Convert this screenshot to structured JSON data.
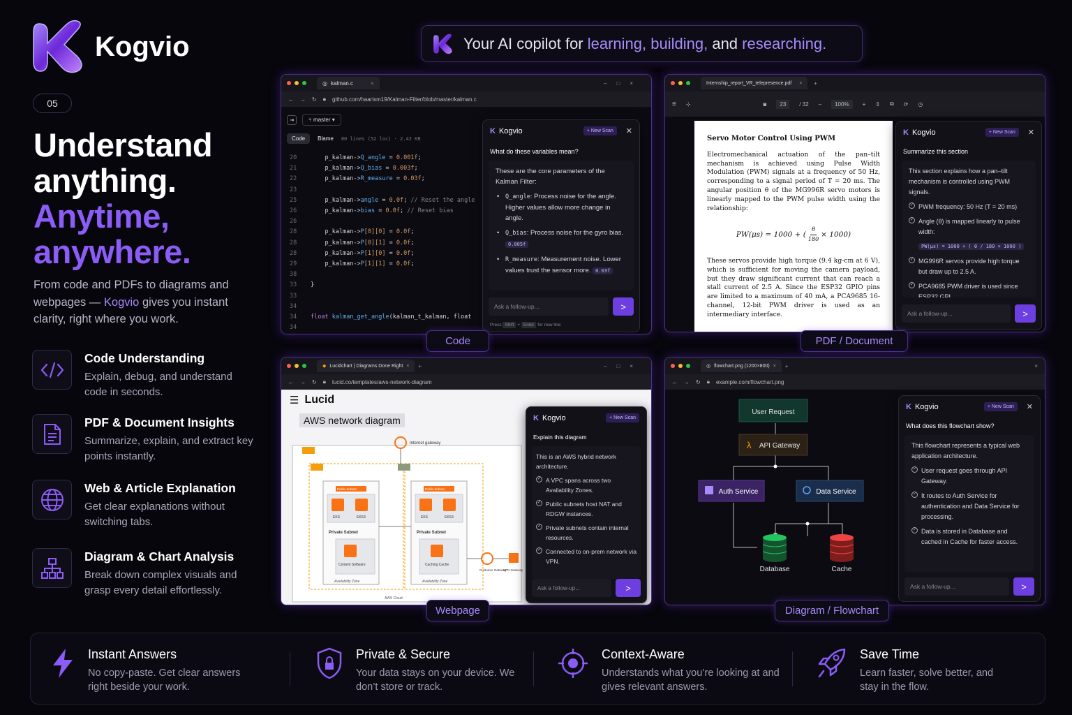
{
  "brand": {
    "name": "Kogvio",
    "slide_number": "05",
    "accent": "#8b5cf6"
  },
  "tagline": {
    "prefix": "Your AI copilot for ",
    "w1": "learning, building,",
    "mid": " and ",
    "w2": "researching."
  },
  "headline": {
    "line1": "Understand",
    "line2": "anything.",
    "line3": "Anytime,",
    "line4": "anywhere."
  },
  "lead": {
    "pre": "From code and PDFs to diagrams and webpages — ",
    "brand": "Kogvio",
    "post": " gives you instant clarity, right where you work."
  },
  "features": [
    {
      "title": "Code Understanding",
      "desc": "Explain, debug, and understand code in seconds.",
      "icon": "code-icon"
    },
    {
      "title": "PDF & Document Insights",
      "desc": "Summarize, explain, and extract key points instantly.",
      "icon": "document-icon"
    },
    {
      "title": "Web & Article Explanation",
      "desc": "Get clear explanations without switching tabs.",
      "icon": "globe-icon"
    },
    {
      "title": "Diagram & Chart Analysis",
      "desc": "Break down complex visuals and grasp every detail effortlessly.",
      "icon": "hierarchy-icon"
    }
  ],
  "panels": {
    "code": {
      "label": "Code",
      "tab": "kalman.c",
      "url": "github.com/haarism19/Kalman-Filter/blob/master/kalman.c",
      "branch": "master",
      "view_tabs": [
        "Code",
        "Blame"
      ],
      "file_info": "80 lines (52 loc) · 2.42 KB",
      "lines": [
        {
          "n": "20",
          "t": "    p_kalman->Q_angle = 0.001f;"
        },
        {
          "n": "21",
          "t": "    p_kalman->Q_bias = 0.003f;"
        },
        {
          "n": "22",
          "t": "    p_kalman->R_measure = 0.03f;"
        },
        {
          "n": "23",
          "t": ""
        },
        {
          "n": "25",
          "t": "    p_kalman->angle = 0.0f; // Reset the angle"
        },
        {
          "n": "26",
          "t": "    p_kalman->bias = 0.0f; // Reset bias"
        },
        {
          "n": "26",
          "t": ""
        },
        {
          "n": "28",
          "t": "    p_kalman->P[0][0] = 0.0f;"
        },
        {
          "n": "28",
          "t": "    p_kalman->P[0][1] = 0.0f;"
        },
        {
          "n": "28",
          "t": "    p_kalman->P[1][0] = 0.0f;"
        },
        {
          "n": "29",
          "t": "    p_kalman->P[1][1] = 0.0f;"
        },
        {
          "n": "38",
          "t": ""
        },
        {
          "n": "33",
          "t": "}"
        },
        {
          "n": "33",
          "t": ""
        },
        {
          "n": "34",
          "t": ""
        },
        {
          "n": "34",
          "t": "float kalman_get_angle(kalman_t_kalman, float"
        },
        {
          "n": "34",
          "t": ""
        }
      ],
      "assistant": {
        "title": "Kogvio",
        "new_scan": "+ New Scan",
        "question": "What do these variables mean?",
        "intro": "These are the core parameters of the Kalman Filter:",
        "bullets": [
          {
            "name": "Q_angle",
            "text": ": Process noise for the angle. Higher values allow more change in angle.",
            "chip": ""
          },
          {
            "name": "Q_bias",
            "text": ": Process noise for the gyro bias.",
            "chip": "0.005f"
          },
          {
            "name": "R_measure",
            "text": ": Measurement noise. Lower values trust the sensor more.",
            "chip": "0.03f"
          }
        ],
        "placeholder": "Ask a follow-up...",
        "hint_pre": "Press",
        "hint_k1": "Shift",
        "hint_plus": "+",
        "hint_k2": "Enter",
        "hint_post": "for new line"
      }
    },
    "pdf": {
      "label": "PDF / Document",
      "tab": "Internship_report_VR_telepresence.pdf",
      "page": "23",
      "pages": "/ 32",
      "zoom": "100%",
      "heading": "Servo Motor Control Using PWM",
      "para1": "Electromechanical actuation of the pan–tilt mechanism is achieved using Pulse Width Modulation (PWM) signals at a frequency of 50 Hz, corresponding to a signal period of T = 20 ms. The angular position θ of the MG996R servo motors is linearly mapped to the PWM pulse width using the relationship:",
      "formula_lhs": "PW(μs) = 1000 + (",
      "formula_num": "θ",
      "formula_den": "180",
      "formula_rhs": "× 1000)",
      "para2": "These servos provide high torque (9.4 kg-cm at 6 V), which is sufficient for moving the camera payload, but they draw significant current that can reach a stall current of 2.5 A. Since the ESP32 GPIO pins are limited to a maximum of 40 mA, a PCA9685 16-channel, 12-bit PWM driver is used as an intermediary interface.",
      "assistant": {
        "title": "Kogvio",
        "new_scan": "+ New Scan",
        "question": "Summarize this section",
        "intro": "This section explains how a pan–tilt mechanism is controlled using PWM signals.",
        "bullets": [
          "PWM frequency: 50 Hz (T = 20 ms)",
          "Angle (θ) is mapped linearly to pulse width:",
          "MG996R servos provide high torque but draw up to 2.5 A.",
          "PCA9685 PWM driver is used since ESP32 GPI..."
        ],
        "formula_chip": "PW(μs) = 1000 + ( θ / 180 × 1000 )",
        "placeholder": "Ask a follow-up..."
      }
    },
    "web": {
      "label": "Webpage",
      "tab": "Lucidchart | Diagrams Done Right",
      "url": "lucid.co/templates/aws-network-diagram",
      "site": "Lucid",
      "diagram_title": "AWS network diagram",
      "labels": {
        "igw": "Internet gateway",
        "private1": "Private Subnet",
        "private2": "Private Subnet",
        "az1": "Availability Zone",
        "az2": "Availability Zone",
        "cgw": "Customer Gateway",
        "vgw": "VPN Gateway",
        "c1": "Content Software",
        "c2": "Caching Cache",
        "e1": "EKS",
        "e2": "EKS3",
        "e3": "EKS",
        "e4": "EKS3",
        "p1": "Public Subnet",
        "p2": "Public Subnet",
        "cloud": "AWS Cloud"
      },
      "assistant": {
        "title": "Kogvio",
        "new_scan": "+ New Scan",
        "question": "Explain this diagram",
        "intro": "This is an AWS hybrid network architecture.",
        "bullets": [
          "A VPC spans across two Availability Zones.",
          "Public subnets host NAT and RDGW instances.",
          "Private subnets contain internal resources.",
          "Connected to on-prem network via VPN."
        ],
        "placeholder": "Ask a follow-up..."
      }
    },
    "flow": {
      "label": "Diagram / Flowchart",
      "tab": "flowchart.png (1200×800)",
      "url": "example.com/flowchart.png",
      "nodes": {
        "user": "User Request",
        "gateway": "API Gateway",
        "auth": "Auth Service",
        "data": "Data Service",
        "db": "Database",
        "cache": "Cache"
      },
      "assistant": {
        "title": "Kogvio",
        "new_scan": "+ New Scan",
        "question": "What does this flowchart show?",
        "intro": "This flowchart represents a typical web application architecture.",
        "bullets": [
          "User request goes through API Gateway.",
          "It routes to Auth Service for authentication and Data Service for processing.",
          "Data is stored in Database and cached in Cache for faster access."
        ],
        "placeholder": "Ask a follow-up..."
      }
    }
  },
  "benefits": [
    {
      "title": "Instant Answers",
      "desc": "No copy-paste. Get clear answers right beside your work.",
      "icon": "lightning-icon"
    },
    {
      "title": "Private & Secure",
      "desc": "Your data stays on your device. We don’t store or track.",
      "icon": "shield-icon"
    },
    {
      "title": "Context-Aware",
      "desc": "Understands what you’re looking at and gives relevant answers.",
      "icon": "target-icon"
    },
    {
      "title": "Save Time",
      "desc": "Learn faster, solve better, and stay in the flow.",
      "icon": "rocket-icon"
    }
  ]
}
